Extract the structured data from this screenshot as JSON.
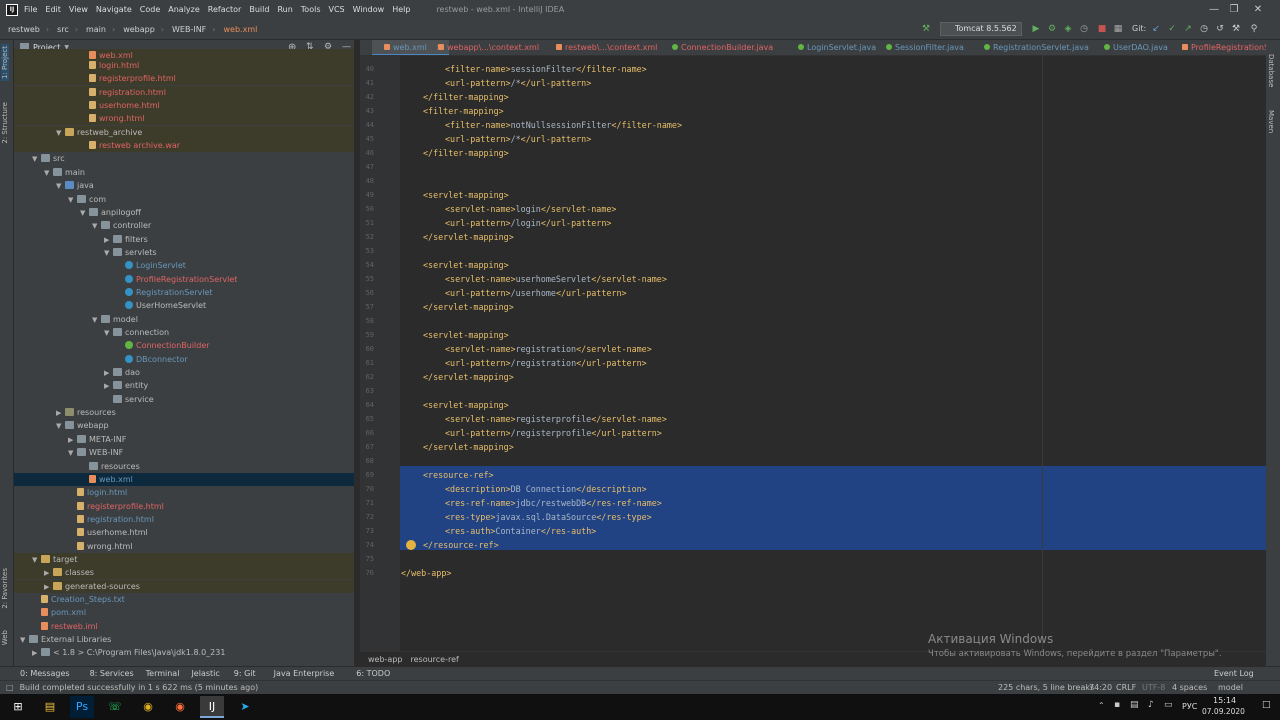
{
  "menubar": {
    "items": [
      "File",
      "Edit",
      "View",
      "Navigate",
      "Code",
      "Analyze",
      "Refactor",
      "Build",
      "Run",
      "Tools",
      "VCS",
      "Window",
      "Help"
    ],
    "window_title": "restweb - web.xml - IntelliJ IDEA"
  },
  "navbar": {
    "crumbs": [
      "restweb",
      "src",
      "main",
      "webapp",
      "WEB-INF",
      "web.xml"
    ],
    "run_config": "Tomcat 8.5.562",
    "git_label": "Git:"
  },
  "sidebar_left": {
    "project": "1: Project",
    "structure": "2: Structure",
    "favorites": "2: Favorites",
    "web": "Web"
  },
  "sidebar_right": {
    "database": "Database",
    "maven": "Maven"
  },
  "project_panel": {
    "title": "Project",
    "tree": [
      {
        "indent": 5,
        "icon": "xml",
        "label": "web.xml",
        "color": "red",
        "partial": true
      },
      {
        "indent": 5,
        "icon": "file",
        "label": "login.html",
        "color": "red"
      },
      {
        "indent": 5,
        "icon": "file",
        "label": "registerprofile.html",
        "color": "red"
      },
      {
        "indent": 5,
        "icon": "file",
        "label": "registration.html",
        "color": "red"
      },
      {
        "indent": 5,
        "icon": "file",
        "label": "userhome.html",
        "color": "red"
      },
      {
        "indent": 5,
        "icon": "file",
        "label": "wrong.html",
        "color": "red"
      },
      {
        "indent": 3,
        "arrow": "down",
        "icon": "foldtg",
        "label": "restweb_archive",
        "color": "wht"
      },
      {
        "indent": 5,
        "icon": "file",
        "label": "restweb archive.war",
        "color": "red"
      },
      {
        "indent": 1,
        "arrow": "down",
        "icon": "fold",
        "label": "src",
        "color": "wht"
      },
      {
        "indent": 2,
        "arrow": "down",
        "icon": "fold",
        "label": "main",
        "color": "wht"
      },
      {
        "indent": 3,
        "arrow": "down",
        "icon": "foldsrc",
        "label": "java",
        "color": "wht"
      },
      {
        "indent": 4,
        "arrow": "down",
        "icon": "fold",
        "label": "com",
        "color": "wht"
      },
      {
        "indent": 5,
        "arrow": "down",
        "icon": "fold",
        "label": "anpilogoff",
        "color": "wht"
      },
      {
        "indent": 6,
        "arrow": "down",
        "icon": "fold",
        "label": "controller",
        "color": "wht"
      },
      {
        "indent": 7,
        "arrow": "right",
        "icon": "fold",
        "label": "filters",
        "color": "wht"
      },
      {
        "indent": 7,
        "arrow": "down",
        "icon": "fold",
        "label": "servlets",
        "color": "wht"
      },
      {
        "indent": 8,
        "icon": "cls",
        "label": "LoginServlet",
        "color": "blu"
      },
      {
        "indent": 8,
        "icon": "cls",
        "label": "ProfileRegistrationServlet",
        "color": "red"
      },
      {
        "indent": 8,
        "icon": "cls",
        "label": "RegistrationServlet",
        "color": "blu"
      },
      {
        "indent": 8,
        "icon": "cls",
        "label": "UserHomeServlet",
        "color": "wht"
      },
      {
        "indent": 6,
        "arrow": "down",
        "icon": "fold",
        "label": "model",
        "color": "wht"
      },
      {
        "indent": 7,
        "arrow": "down",
        "icon": "fold",
        "label": "connection",
        "color": "wht"
      },
      {
        "indent": 8,
        "icon": "clsg",
        "label": "ConnectionBuilder",
        "color": "red"
      },
      {
        "indent": 8,
        "icon": "cls",
        "label": "DBconnector",
        "color": "blu"
      },
      {
        "indent": 7,
        "arrow": "right",
        "icon": "fold",
        "label": "dao",
        "color": "wht"
      },
      {
        "indent": 7,
        "arrow": "right",
        "icon": "fold",
        "label": "entity",
        "color": "wht"
      },
      {
        "indent": 7,
        "icon": "fold",
        "label": "service",
        "color": "wht"
      },
      {
        "indent": 3,
        "arrow": "right",
        "icon": "foldrs",
        "label": "resources",
        "color": "wht"
      },
      {
        "indent": 3,
        "arrow": "down",
        "icon": "fold",
        "label": "webapp",
        "color": "wht"
      },
      {
        "indent": 4,
        "arrow": "right",
        "icon": "fold",
        "label": "META-INF",
        "color": "wht"
      },
      {
        "indent": 4,
        "arrow": "down",
        "icon": "fold",
        "label": "WEB-INF",
        "color": "wht"
      },
      {
        "indent": 5,
        "icon": "fold",
        "label": "resources",
        "color": "wht"
      },
      {
        "indent": 5,
        "icon": "xml",
        "label": "web.xml",
        "color": "blu",
        "selected": true
      },
      {
        "indent": 4,
        "icon": "file",
        "label": "login.html",
        "color": "blu"
      },
      {
        "indent": 4,
        "icon": "file",
        "label": "registerprofile.html",
        "color": "red"
      },
      {
        "indent": 4,
        "icon": "file",
        "label": "registration.html",
        "color": "blu"
      },
      {
        "indent": 4,
        "icon": "file",
        "label": "userhome.html",
        "color": "wht"
      },
      {
        "indent": 4,
        "icon": "file",
        "label": "wrong.html",
        "color": "wht"
      },
      {
        "indent": 1,
        "arrow": "down",
        "icon": "foldtg",
        "label": "target",
        "color": "wht"
      },
      {
        "indent": 2,
        "arrow": "right",
        "icon": "foldtg",
        "label": "classes",
        "color": "wht"
      },
      {
        "indent": 2,
        "arrow": "right",
        "icon": "foldtg",
        "label": "generated-sources",
        "color": "wht"
      },
      {
        "indent": 1,
        "icon": "file",
        "label": "Creation_Steps.txt",
        "color": "blu"
      },
      {
        "indent": 1,
        "icon": "xml",
        "label": "pom.xml",
        "color": "blu"
      },
      {
        "indent": 1,
        "icon": "xml",
        "label": "restweb.iml",
        "color": "red"
      },
      {
        "indent": 0,
        "arrow": "down",
        "icon": "fold",
        "label": "External Libraries",
        "color": "wht"
      },
      {
        "indent": 1,
        "arrow": "right",
        "icon": "fold",
        "label": "< 1.8 >  C:\\Program Files\\Java\\jdk1.8.0_231",
        "color": "wht"
      }
    ]
  },
  "editor_tabs": [
    {
      "label": "web.xml",
      "color": "blu",
      "active": true
    },
    {
      "label": "webapp\\...\\context.xml",
      "color": "red"
    },
    {
      "label": "restweb\\...\\context.xml",
      "color": "red"
    },
    {
      "label": "ConnectionBuilder.java",
      "color": "red"
    },
    {
      "label": "LoginServlet.java",
      "color": "blu"
    },
    {
      "label": "SessionFilter.java",
      "color": "blu"
    },
    {
      "label": "RegistrationServlet.java",
      "color": "blu"
    },
    {
      "label": "UserDAO.java",
      "color": "blu"
    },
    {
      "label": "ProfileRegistrationServ",
      "color": "red"
    }
  ],
  "code_lines": [
    {
      "n": "40",
      "indent": 2,
      "text": "<filter-name>sessionFilter</filter-name>"
    },
    {
      "n": "41",
      "indent": 2,
      "text": "<url-pattern>/*</url-pattern>"
    },
    {
      "n": "42",
      "indent": 1,
      "text": "</filter-mapping>"
    },
    {
      "n": "43",
      "indent": 1,
      "text": "<filter-mapping>"
    },
    {
      "n": "44",
      "indent": 2,
      "text": "<filter-name>notNullsessionFilter</filter-name>"
    },
    {
      "n": "45",
      "indent": 2,
      "text": "<url-pattern>/*</url-pattern>"
    },
    {
      "n": "46",
      "indent": 1,
      "text": "</filter-mapping>"
    },
    {
      "n": "47",
      "indent": 0,
      "text": ""
    },
    {
      "n": "48",
      "indent": 0,
      "text": ""
    },
    {
      "n": "49",
      "indent": 1,
      "text": "<servlet-mapping>"
    },
    {
      "n": "50",
      "indent": 2,
      "text": "<servlet-name>login</servlet-name>"
    },
    {
      "n": "51",
      "indent": 2,
      "text": "<url-pattern>/login</url-pattern>"
    },
    {
      "n": "52",
      "indent": 1,
      "text": "</servlet-mapping>"
    },
    {
      "n": "53",
      "indent": 0,
      "text": ""
    },
    {
      "n": "54",
      "indent": 1,
      "text": "<servlet-mapping>"
    },
    {
      "n": "55",
      "indent": 2,
      "text": "<servlet-name>userhomeServlet</servlet-name>"
    },
    {
      "n": "56",
      "indent": 2,
      "text": "<url-pattern>/userhome</url-pattern>"
    },
    {
      "n": "57",
      "indent": 1,
      "text": "</servlet-mapping>"
    },
    {
      "n": "58",
      "indent": 0,
      "text": ""
    },
    {
      "n": "59",
      "indent": 1,
      "text": "<servlet-mapping>"
    },
    {
      "n": "60",
      "indent": 2,
      "text": "<servlet-name>registration</servlet-name>"
    },
    {
      "n": "61",
      "indent": 2,
      "text": "<url-pattern>/registration</url-pattern>"
    },
    {
      "n": "62",
      "indent": 1,
      "text": "</servlet-mapping>"
    },
    {
      "n": "63",
      "indent": 0,
      "text": ""
    },
    {
      "n": "64",
      "indent": 1,
      "text": "<servlet-mapping>"
    },
    {
      "n": "65",
      "indent": 2,
      "text": "<servlet-name>registerprofile</servlet-name>"
    },
    {
      "n": "66",
      "indent": 2,
      "text": "<url-pattern>/registerprofile</url-pattern>"
    },
    {
      "n": "67",
      "indent": 1,
      "text": "</servlet-mapping>"
    },
    {
      "n": "68",
      "indent": 0,
      "text": ""
    },
    {
      "n": "69",
      "indent": 1,
      "text": "<resource-ref>"
    },
    {
      "n": "70",
      "indent": 2,
      "text": "<description>DB Connection</description>"
    },
    {
      "n": "71",
      "indent": 2,
      "text": "<res-ref-name>jdbc/restwebDB</res-ref-name>"
    },
    {
      "n": "72",
      "indent": 2,
      "text": "<res-type>javax.sql.DataSource</res-type>"
    },
    {
      "n": "73",
      "indent": 2,
      "text": "<res-auth>Container</res-auth>"
    },
    {
      "n": "74",
      "indent": 1,
      "text": "</resource-ref>"
    },
    {
      "n": "75",
      "indent": 0,
      "text": ""
    },
    {
      "n": "76",
      "indent": 0,
      "text": "</web-app>"
    }
  ],
  "breadcrumb": [
    "web-app",
    "resource-ref"
  ],
  "activation": {
    "title": "Активация Windows",
    "subtitle": "Чтобы активировать Windows, перейдите в раздел \"Параметры\"."
  },
  "toolwindows": [
    "0: Messages",
    "8: Services",
    "Terminal",
    "Jelastic",
    "9: Git",
    "Java Enterprise",
    "6: TODO"
  ],
  "event_log": "Event Log",
  "status": {
    "message": "Build completed successfully in 1 s 622 ms (5 minutes ago)",
    "chars": "225 chars, 5 line breaks",
    "position": "74:20",
    "line_sep": "CRLF",
    "encoding": "UTF-8",
    "indent": "4 spaces",
    "module": "model"
  },
  "taskbar": {
    "lang": "РУС",
    "time": "15:14",
    "date": "07.09.2020"
  }
}
